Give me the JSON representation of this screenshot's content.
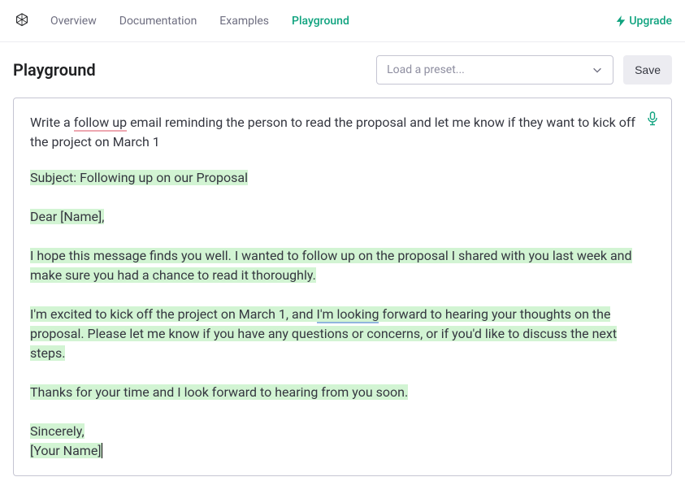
{
  "nav": {
    "links": [
      "Overview",
      "Documentation",
      "Examples",
      "Playground"
    ],
    "active_index": 3,
    "upgrade": "Upgrade"
  },
  "header": {
    "title": "Playground",
    "preset_placeholder": "Load a preset...",
    "save_label": "Save"
  },
  "editor": {
    "prompt_pre": "Write a ",
    "prompt_spell": "follow up",
    "prompt_post": " email reminding the person to read the proposal and let me know if they want to kick off the project on March 1",
    "gen": {
      "subject": "Subject: Following up on our Proposal",
      "greeting": "Dear [Name],",
      "p1": "I hope this message finds you well. I wanted to follow up on the proposal I shared with you last week and make sure you had a chance to read it thoroughly.",
      "p2_a": "I'm excited to kick off the project on March 1, and ",
      "p2_g": "I'm looking",
      "p2_b": " forward to hearing your thoughts on the proposal. Please let me know if you have any questions or concerns, or if you'd like to discuss the next steps.",
      "p3": "Thanks for your time and I look forward to hearing from you soon.",
      "signoff1": "Sincerely,",
      "signoff2": "[Your Name]"
    }
  }
}
